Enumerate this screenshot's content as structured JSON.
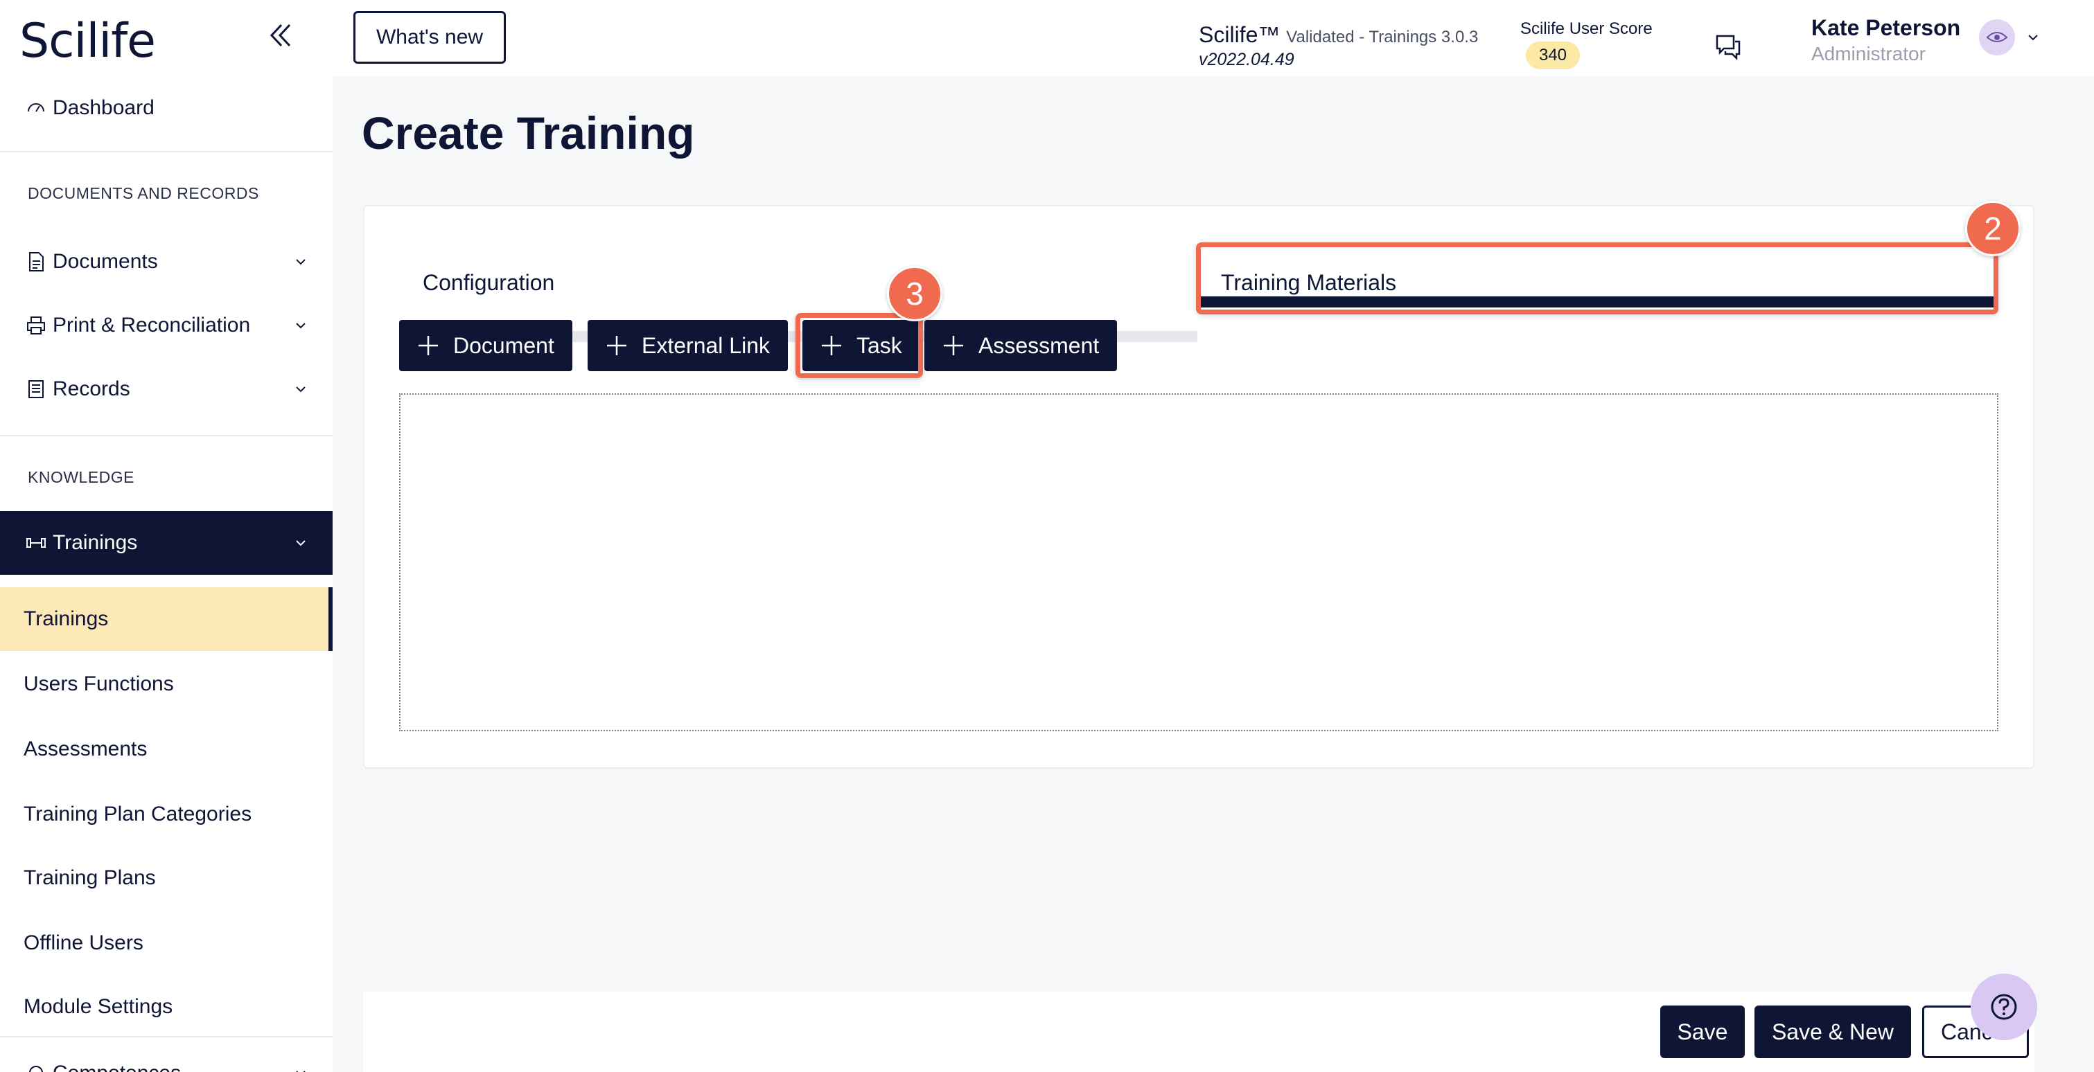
{
  "app": {
    "logo": "Scilife"
  },
  "sidebar": {
    "dashboard": "Dashboard",
    "section_docs": "DOCUMENTS AND RECORDS",
    "documents": "Documents",
    "print": "Print & Reconciliation",
    "records": "Records",
    "section_knowledge": "KNOWLEDGE",
    "trainings_group": "Trainings",
    "sub_items": [
      "Trainings",
      "Users Functions",
      "Assessments",
      "Training Plan Categories",
      "Training Plans",
      "Offline Users",
      "Module Settings"
    ],
    "competences": "Competences"
  },
  "header": {
    "whats_new": "What's new",
    "brand": "Scilife™",
    "brand_sub": "Validated - Trainings 3.0.3",
    "version": "v2022.04.49",
    "score_label": "Scilife User Score",
    "score_value": "340",
    "user_name": "Kate Peterson",
    "user_role": "Administrator"
  },
  "main": {
    "title": "Create Training",
    "tabs": [
      "Configuration",
      "Training Materials"
    ],
    "add_buttons": [
      "Document",
      "External Link",
      "Task",
      "Assessment"
    ],
    "step_tab": "2",
    "step_task": "3"
  },
  "footer": {
    "save": "Save",
    "save_new": "Save & New",
    "cancel": "Cancel"
  },
  "colors": {
    "navy": "#0f1535",
    "highlight": "#f06a4f",
    "selected_bg": "#fde9b8",
    "score_bg": "#fde9a6"
  }
}
